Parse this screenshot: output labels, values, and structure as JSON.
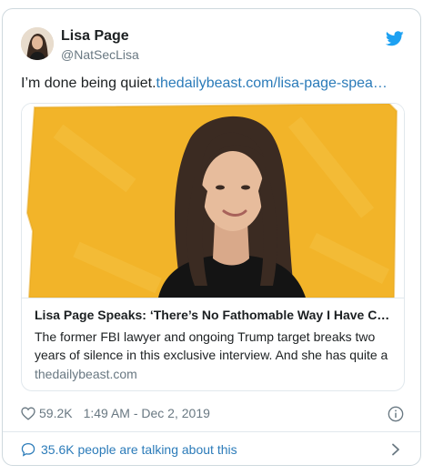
{
  "author": {
    "name": "Lisa Page",
    "handle": "@NatSecLisa"
  },
  "tweet": {
    "text": "I’m done being quiet.",
    "link": "thedailybeast.com/lisa-page-spea…"
  },
  "card": {
    "title": "Lisa Page Speaks: ‘There’s No Fathomable Way I Have C…",
    "description": "The former FBI lawyer and ongoing Trump target breaks two years of silence in this exclusive interview. And she has quite a",
    "domain": "thedailybeast.com"
  },
  "footer": {
    "likes": "59.2K",
    "timestamp": "1:49 AM - Dec 2, 2019",
    "talking": "35.6K people are talking about this"
  },
  "colors": {
    "twitter_blue": "#1da1f2",
    "link": "#2b7bb9",
    "secondary_text": "#697882",
    "card_background": "#f2b429"
  },
  "icons": [
    "twitter-bird-icon",
    "heart-icon",
    "info-icon",
    "speech-bubble-icon",
    "chevron-right-icon"
  ]
}
